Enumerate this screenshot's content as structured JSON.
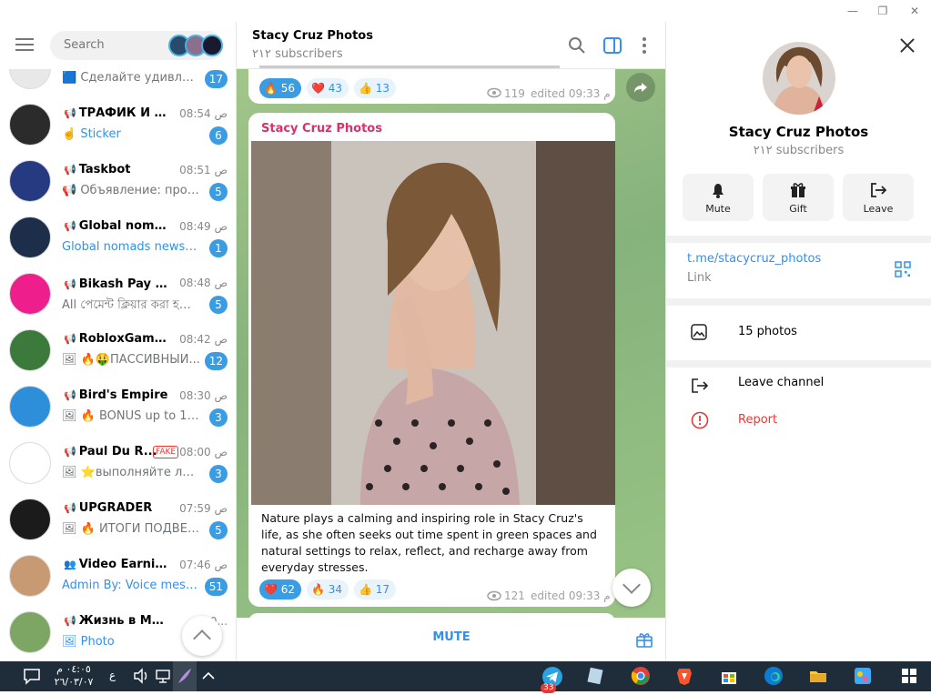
{
  "sidebar": {
    "search_placeholder": "Search",
    "chats": [
      {
        "name": "",
        "name_icon": "",
        "time": "",
        "message": "🟦 Сделайте удивленн...",
        "message_blue": false,
        "badge": "17",
        "fake": false,
        "avatar_color": "#e8e8e8"
      },
      {
        "name": "ТРАФИК И ПРО...",
        "name_icon": "📢",
        "time": "08:54 ص",
        "message": "☝️ Sticker",
        "message_blue": true,
        "badge": "6",
        "fake": false,
        "avatar_color": "#2b2b2b"
      },
      {
        "name": "Taskbot",
        "name_icon": "📢",
        "time": "08:51 ص",
        "message": "📢 Объявление: пром...",
        "message_blue": false,
        "badge": "5",
        "fake": false,
        "avatar_color": "#253a80"
      },
      {
        "name": "Global nomads ...",
        "name_icon": "📢",
        "time": "08:49 ص",
        "message": "Global nomads news EN ...",
        "message_blue": true,
        "badge": "1",
        "fake": false,
        "avatar_color": "#1c2e4a"
      },
      {
        "name": "Bikash Pay - বি...",
        "name_icon": "📢",
        "time": "08:48 ص",
        "message": "All পেমেন্ট ক্লিয়ার করা হয়ে...",
        "message_blue": false,
        "badge": "5",
        "fake": false,
        "avatar_color": "#ee1f8c"
      },
      {
        "name": "RobloxGame🔰",
        "name_icon": "📢",
        "time": "08:42 ص",
        "message": "🖼 🔥🤑ПАССИВНЫЙ...",
        "message_blue": false,
        "badge": "12",
        "fake": false,
        "avatar_color": "#3b7a3b"
      },
      {
        "name": "Bird's Empire",
        "name_icon": "📢",
        "time": "08:30 ص",
        "message": "🖼 🔥 BONUS up to 150...",
        "message_blue": false,
        "badge": "3",
        "fake": false,
        "avatar_color": "#2d8fd9"
      },
      {
        "name": "Paul Du R...",
        "name_icon": "📢",
        "time": "08:00 ص",
        "message": "🖼 ⭐выполняйте легк...",
        "message_blue": false,
        "badge": "3",
        "fake": true,
        "fake_label": "FAKE",
        "avatar_color": "#ffffff"
      },
      {
        "name": "UPGRADER",
        "name_icon": "📢",
        "time": "07:59 ص",
        "message": "🖼 🔥 ИТОГИ ПОДВЕД...",
        "message_blue": false,
        "badge": "5",
        "fake": false,
        "avatar_color": "#1b1b1b"
      },
      {
        "name": "Video Earning ...",
        "name_icon": "👥",
        "time": "07:46 ص",
        "message": "Admin By: Voice message",
        "message_blue": true,
        "badge": "51",
        "fake": false,
        "avatar_color": "#c79a73"
      },
      {
        "name": "Жизнь в Мемах",
        "name_icon": "📢",
        "time": "0...",
        "message": "🖼 Photo",
        "message_blue": true,
        "badge": "",
        "fake": false,
        "avatar_color": "#7da564"
      }
    ]
  },
  "chat": {
    "title": "Stacy Cruz Photos",
    "subscribers": "٢١٢ subscribers",
    "prev_post": {
      "reactions": [
        {
          "emoji": "🔥",
          "count": "56",
          "selected": true
        },
        {
          "emoji": "❤️",
          "count": "43",
          "selected": false
        },
        {
          "emoji": "👍",
          "count": "13",
          "selected": false
        }
      ],
      "views": "119",
      "edited": "edited 09:33 م"
    },
    "post": {
      "author": "Stacy Cruz Photos",
      "text": "Nature plays a calming and inspiring role in Stacy Cruz's life, as she often seeks out time spent in green spaces and natural settings to relax, reflect, and recharge away from everyday stresses.",
      "reactions": [
        {
          "emoji": "❤️",
          "count": "62",
          "selected": true
        },
        {
          "emoji": "🔥",
          "count": "34",
          "selected": false
        },
        {
          "emoji": "👍",
          "count": "17",
          "selected": false
        }
      ],
      "views": "121",
      "edited": "edited 09:33 م"
    },
    "mute_label": "MUTE"
  },
  "profile": {
    "name": "Stacy Cruz Photos",
    "subscribers": "٢١٢ subscribers",
    "buttons": {
      "mute": "Mute",
      "gift": "Gift",
      "leave": "Leave"
    },
    "link": "t.me/stacycruz_photos",
    "link_label": "Link",
    "photos": "15 photos",
    "leave_channel": "Leave channel",
    "report": "Report"
  },
  "taskbar": {
    "time": "٠٤:٠٥ م",
    "date": "٢٦/٠٣/٠٧",
    "lang": "ع",
    "telegram_badge": "33"
  },
  "colors": {
    "accent": "#3390ec",
    "badge": "#3a9de3",
    "report": "#e53935",
    "taskbar": "#1f2d3a"
  }
}
